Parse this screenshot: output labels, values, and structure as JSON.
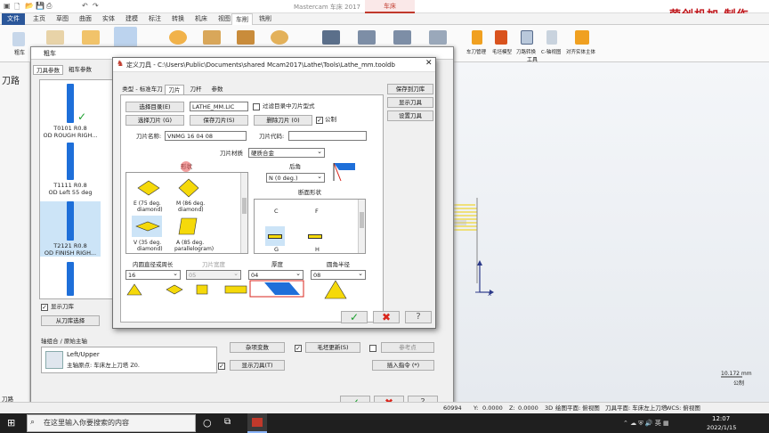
{
  "app": {
    "window_title": "Mastercam 车床 2017",
    "context_tab": "车床",
    "brand_text": "荣创机加 制作"
  },
  "ribbon_tabs": [
    "文件",
    "主页",
    "草图",
    "曲面",
    "实体",
    "建模",
    "标注",
    "转换",
    "机床",
    "视图",
    "车削",
    "铣削"
  ],
  "ribbon": {
    "left_label": "粗车",
    "group_labels": [
      "车刀管理",
      "毛坯模型",
      "刀路转换",
      "C-轴视图",
      "对齐实体主体"
    ],
    "group_title": "工具"
  },
  "left_panel": {
    "title": "刀路",
    "bottom_tab": "刀路"
  },
  "rough_dialog": {
    "title": "粗车",
    "tabs": [
      "刀具参数",
      "粗车参数"
    ],
    "tools": [
      {
        "line1": "T0101 R0.8",
        "line2": "OD ROUGH RIGH..."
      },
      {
        "line1": "T1111 R0.8",
        "line2": "OD Left 55 deg"
      },
      {
        "line1": "T2121 R0.8",
        "line2": "OD FINISH RIGH..."
      }
    ],
    "show_library_label": "显示刀库",
    "select_from_library": "从刀库选择",
    "axis_combo_label": "轴组合 / 原始主轴",
    "axis_combo_value": "Left/Upper",
    "axis_combo_detail": "主轴原点: 车床左上刀塔  Z0.",
    "misc_vars_button": "杂项变数",
    "stock_update_button": "毛坯更新(S)",
    "ref_point_button": "参考点",
    "show_tool_button": "显示刀具(T)",
    "insert_cmd_button": "插入指令 (*)"
  },
  "tool_dialog": {
    "title": "定义刀具 - C:\\Users\\Public\\Documents\\shared Mcam2017\\Lathe\\Tools\\Lathe_mm.tooldb",
    "tabs": [
      "类型 - 标准车刀",
      "刀片",
      "刀杆",
      "参数"
    ],
    "select_catalog": "选择目录(E)",
    "catalog_value": "LATHE_MM.LIC",
    "filter_label": "过滤目录中刀片型式",
    "select_insert": "选择刀片 (G)",
    "save_insert": "保存刀片(S)",
    "delete_insert": "删除刀片 (0)",
    "metric_label": "公制",
    "insert_name_label": "刀片名称:",
    "insert_name_value": "VNMG 16 04 08",
    "insert_code_label": "刀片代码:",
    "insert_code_value": "",
    "insert_material_label": "刀片材质",
    "insert_material_value": "硬质合金",
    "shape_label": "形状",
    "shapes": [
      {
        "name": "E (75 deg.",
        "sub": "diamond)"
      },
      {
        "name": "M (86 deg.",
        "sub": "diamond)"
      },
      {
        "name": "V (35 deg.",
        "sub": "diamond)"
      },
      {
        "name": "A (85 deg.",
        "sub": "parallelogram)"
      }
    ],
    "relief_label": "后角",
    "relief_value": "N (0 deg.)",
    "cross_section_label": "断面形状",
    "cross_sections": [
      "C",
      "F",
      "G",
      "H"
    ],
    "ic_label": "内圆直径或周长",
    "ic_value": "16",
    "thickness_label_disabled": "刀片宽度",
    "thickness_disabled_value": "05",
    "thick_label": "厚度",
    "thick_value": "04",
    "radius_label": "圆角半径",
    "radius_value": "08",
    "save_to_lib": "保存到刀库",
    "show_tool": "显示刀具",
    "set_tool": "设置刀具"
  },
  "status": {
    "y_label": "Y:",
    "y_value": "0.0000",
    "z_label": "Z:",
    "z_value": "0.0000",
    "mode": "3D",
    "plane": "绘图平面: 俯视图",
    "tool_plane": "刀具平面: 车床左上刀塔",
    "wcs": "WCS: 俯视图",
    "left_value": "60994"
  },
  "scale": {
    "value": "10.172 mm",
    "unit": "公制"
  },
  "taskbar": {
    "search_placeholder": "在这里输入你要搜索的内容",
    "time": "12:07",
    "date": "2022/1/15"
  },
  "colors": {
    "accent": "#2b579a",
    "brand": "#c0161b",
    "blade": "#1e6fd9",
    "insert": "#f5d90a"
  }
}
